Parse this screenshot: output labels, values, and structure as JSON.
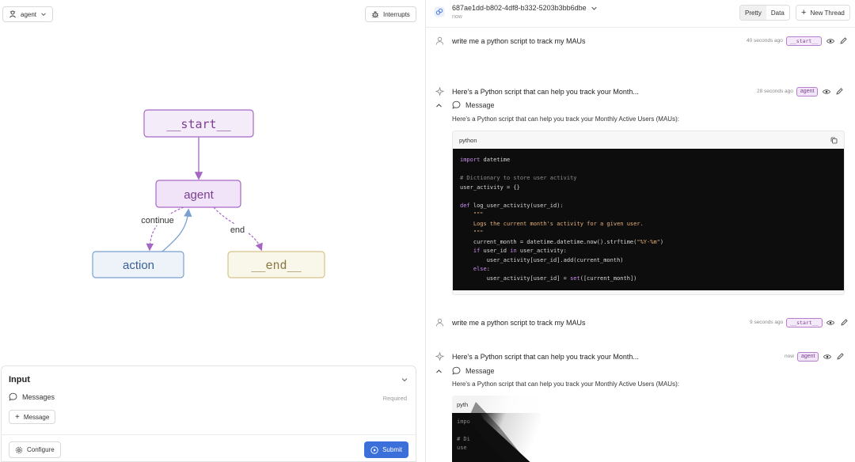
{
  "left": {
    "graph_selector": {
      "label": "agent"
    },
    "interrupts_label": "Interrupts",
    "graph": {
      "nodes": {
        "start": "__start__",
        "agent": "agent",
        "action": "action",
        "end": "__end__"
      },
      "edges": {
        "continue": "continue",
        "end": "end"
      }
    },
    "input": {
      "title": "Input",
      "messages_label": "Messages",
      "required": "Required",
      "message_button": "Message",
      "configure_button": "Configure",
      "submit_button": "Submit"
    }
  },
  "right": {
    "thread": {
      "id": "687ae1dd-b802-4df8-b332-5203b3bb6dbe",
      "time": "now"
    },
    "view_tabs": [
      "Pretty",
      "Data"
    ],
    "new_thread": "New Thread",
    "turns": [
      {
        "role": "user",
        "text": "write me a python script to track my MAUs",
        "time": "40 seconds ago",
        "node": "__start__"
      },
      {
        "role": "ai",
        "text": "Here's a Python script that can help you track your Month...",
        "time": "28 seconds ago",
        "node": "agent",
        "message_label": "Message",
        "body": "Here's a Python script that can help you track your Monthly Active Users (MAUs):",
        "code_lang": "python"
      },
      {
        "role": "user",
        "text": "write me a python script to track my MAUs",
        "time": "9 seconds ago",
        "node": "__start__"
      },
      {
        "role": "ai",
        "text": "Here's a Python script that can help you track your Month...",
        "time": "now",
        "node": "agent",
        "message_label": "Message",
        "body": "Here's a Python script that can help you track your Monthly Active Users (MAUs):",
        "code_lang": "pyth"
      }
    ],
    "code_lines": [
      "import datetime",
      "",
      "# Dictionary to store user activity",
      "user_activity = {}",
      "",
      "def log_user_activity(user_id):",
      "    \"\"\"",
      "    Logs the current month's activity for a given user.",
      "    \"\"\"",
      "    current_month = datetime.datetime.now().strftime(\"%Y-%m\")",
      "    if user_id in user_activity:",
      "        user_activity[user_id].add(current_month)",
      "    else:",
      "        user_activity[user_id] = set([current_month])"
    ],
    "partial_code": [
      "impo",
      "",
      "# Di",
      "use"
    ]
  }
}
